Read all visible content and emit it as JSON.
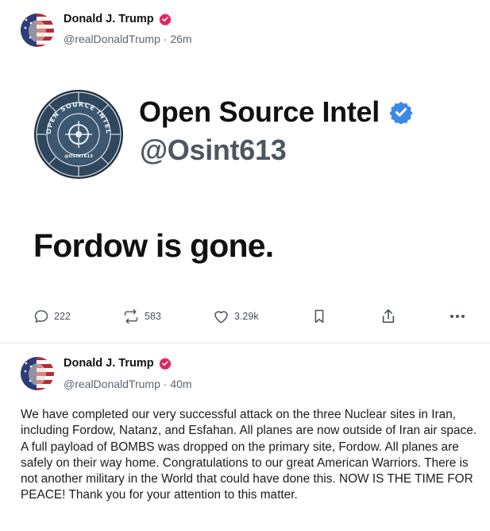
{
  "posts": [
    {
      "author": {
        "name": "Donald J. Trump",
        "handle": "@realDonaldTrump",
        "time": "26m"
      },
      "embedded_image": {
        "account_name": "Open Source Intel",
        "account_handle": "@Osint613",
        "logo_text": "OPEN SOURCE INTEL",
        "logo_bottom_text": "@OSINT613",
        "quote": "Fordow is gone."
      },
      "actions": {
        "replies": "222",
        "reposts": "583",
        "likes": "3.29k"
      }
    },
    {
      "author": {
        "name": "Donald J. Trump",
        "handle": "@realDonaldTrump",
        "time": "40m"
      },
      "text": "We have completed our very successful attack on the three Nuclear sites in Iran, including Fordow, Natanz, and Esfahan. All planes are now outside of Iran air space. A full payload of BOMBS was dropped on the primary site, Fordow. All planes are safely on their way home. Congratulations to our great American Warriors. There is not another military in the World that could have done this. NOW IS THE TIME FOR PEACE! Thank you for your attention to this matter."
    }
  ],
  "colors": {
    "verified_red": "#e0245e",
    "verified_blue": "#3b88e8",
    "muted": "#5b6670",
    "divider": "#e6e6e6"
  },
  "icons": [
    "reply-icon",
    "repost-icon",
    "like-icon",
    "bookmark-icon",
    "share-icon",
    "more-icon"
  ]
}
